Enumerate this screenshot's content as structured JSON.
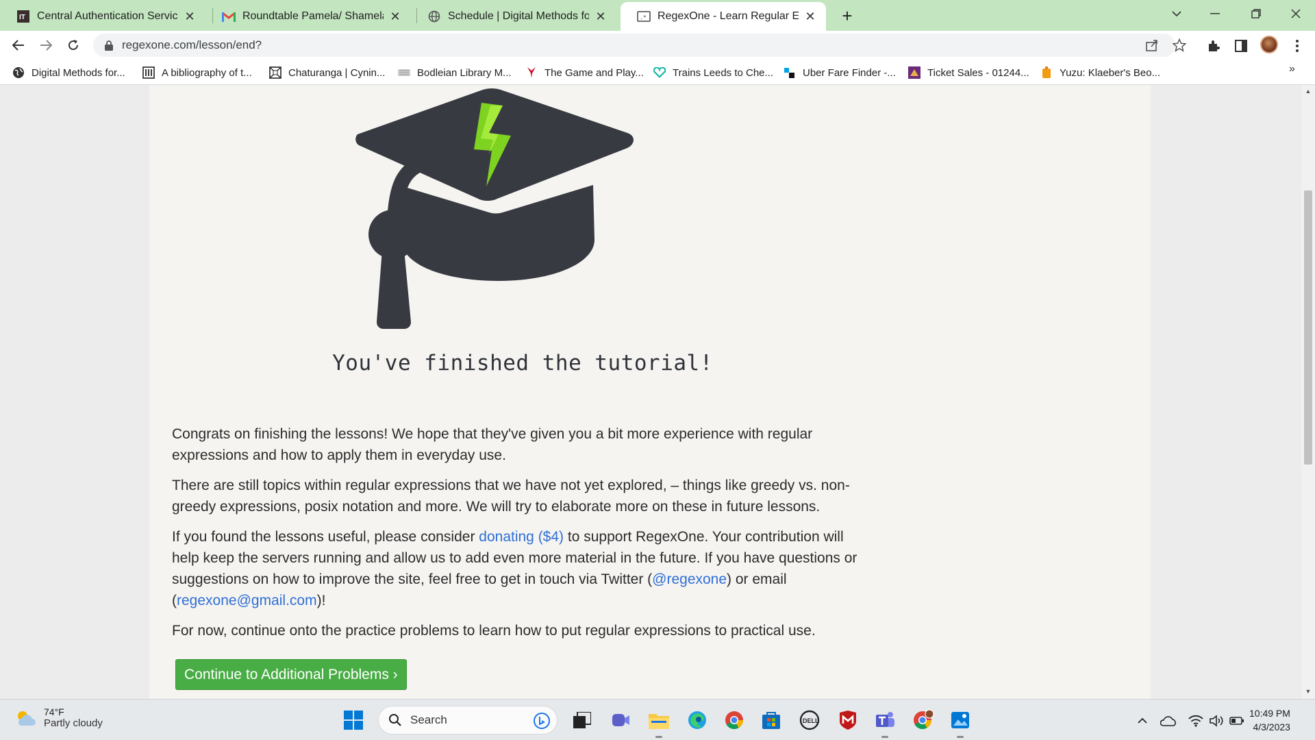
{
  "browser": {
    "tabs": [
      {
        "title": "Central Authentication Service",
        "icon": "it-services-icon"
      },
      {
        "title": "Roundtable Pamela/ Shamela new",
        "icon": "gmail-icon"
      },
      {
        "title": "Schedule | Digital Methods for Hi",
        "icon": "globe-icon"
      },
      {
        "title": "RegexOne - Learn Regular Expres",
        "icon": "regexone-icon",
        "active": true
      }
    ],
    "url": "regexone.com/lesson/end?",
    "bookmarks": [
      {
        "label": "Digital Methods for...",
        "icon": "globe-icon"
      },
      {
        "label": "A bibliography of t...",
        "icon": "library-icon"
      },
      {
        "label": "Chaturanga | Cynin...",
        "icon": "chaturanga-icon"
      },
      {
        "label": "Bodleian Library M...",
        "icon": "bodleian-icon"
      },
      {
        "label": "The Game and Play...",
        "icon": "bookmark-red-icon"
      },
      {
        "label": "Trains Leeds to Che...",
        "icon": "trainline-icon"
      },
      {
        "label": "Uber Fare Finder -...",
        "icon": "uber-icon"
      },
      {
        "label": "Ticket Sales - 01244...",
        "icon": "ticket-icon"
      },
      {
        "label": "Yuzu: Klaeber's Beo...",
        "icon": "yuzu-icon"
      }
    ],
    "bookmarks_overflow": "»"
  },
  "page": {
    "finished_title": "You've finished the tutorial!",
    "paragraph1": "Congrats on finishing the lessons! We hope that they've given you a bit more experience with regular expressions and how to apply them in everyday use.",
    "paragraph2": "There are still topics within regular expressions that we have not yet explored, – things like greedy vs. non-greedy expressions, posix notation and more. We will try to elaborate more on these in future lessons.",
    "paragraph3_part1": "If you found the lessons useful, please consider ",
    "donate_link": "donating ($4)",
    "paragraph3_part2": " to support RegexOne. Your contribution will help keep the servers running and allow us to add even more material in the future. If you have questions or suggestions on how to improve the site, feel free to get in touch via Twitter (",
    "twitter_link": "@regexone",
    "paragraph3_part3": ") or email (",
    "email_link": "regexone@gmail.com",
    "paragraph3_part4": ")!",
    "paragraph4": "For now, continue onto the practice problems to learn how to put regular expressions to practical use.",
    "continue_button": "Continue to Additional Problems ›"
  },
  "taskbar": {
    "weather_temp": "74°F",
    "weather_condition": "Partly cloudy",
    "search_label": "Search",
    "time": "10:49 PM",
    "date": "4/3/2023"
  },
  "colors": {
    "tabstrip": "#c3e6c0",
    "cap": "#383a42",
    "bolt": "#7ed321",
    "link": "#2f6fd6",
    "button": "#49ad45"
  }
}
